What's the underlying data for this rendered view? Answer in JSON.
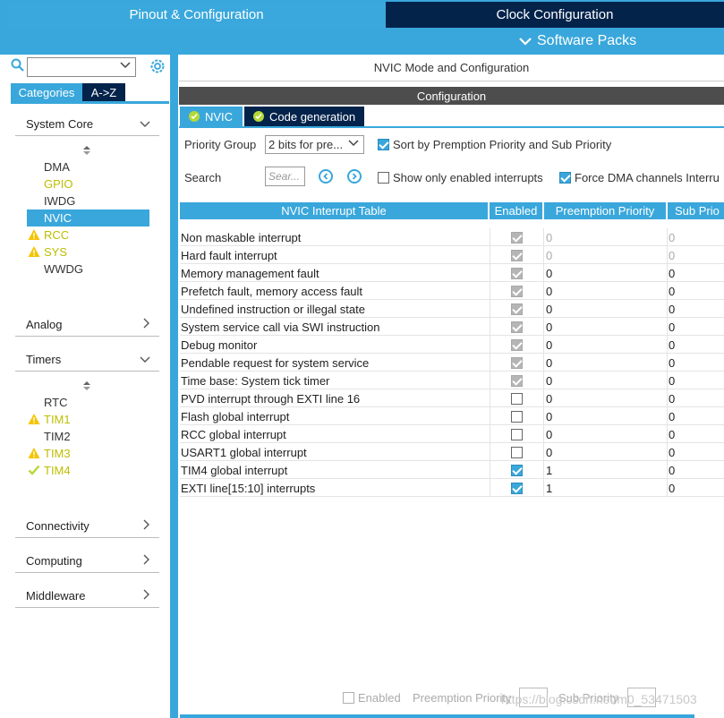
{
  "top": {
    "tab_pinout": "Pinout & Configuration",
    "tab_clock": "Clock Configuration",
    "software_packs": "Software Packs"
  },
  "sidebar": {
    "tab_categories": "Categories",
    "tab_az": "A->Z",
    "sections": {
      "system_core": "System Core",
      "analog": "Analog",
      "timers": "Timers",
      "connectivity": "Connectivity",
      "computing": "Computing",
      "middleware": "Middleware"
    },
    "system_core_items": [
      {
        "label": "DMA",
        "status": "none"
      },
      {
        "label": "GPIO",
        "status": "green"
      },
      {
        "label": "IWDG",
        "status": "none"
      },
      {
        "label": "NVIC",
        "status": "selected"
      },
      {
        "label": "RCC",
        "status": "warning"
      },
      {
        "label": "SYS",
        "status": "warning"
      },
      {
        "label": "WWDG",
        "status": "none"
      }
    ],
    "timers_items": [
      {
        "label": "RTC",
        "status": "none"
      },
      {
        "label": "TIM1",
        "status": "warning"
      },
      {
        "label": "TIM2",
        "status": "none"
      },
      {
        "label": "TIM3",
        "status": "warning"
      },
      {
        "label": "TIM4",
        "status": "ok"
      }
    ]
  },
  "main": {
    "mode_title": "NVIC Mode and Configuration",
    "config_title": "Configuration",
    "tab_nvic": "NVIC",
    "tab_codegen": "Code generation",
    "priority_group_label": "Priority Group",
    "priority_group_value": "2 bits for pre...",
    "sort_label": "Sort by Premption Priority and Sub Priority",
    "sort_checked": true,
    "search_label": "Search",
    "search_placeholder": "Sear...",
    "show_enabled_label": "Show only enabled interrupts",
    "show_enabled_checked": false,
    "force_dma_label": "Force DMA channels Interru",
    "force_dma_checked": true,
    "table": {
      "headers": [
        "NVIC Interrupt Table",
        "Enabled",
        "Preemption Priority",
        "Sub Prio"
      ],
      "rows": [
        {
          "name": "Non maskable interrupt",
          "enabled": "fixed",
          "pre": "0",
          "sub": "0",
          "grey": true
        },
        {
          "name": "Hard fault interrupt",
          "enabled": "fixed",
          "pre": "0",
          "sub": "0",
          "grey": true
        },
        {
          "name": "Memory management fault",
          "enabled": "fixed",
          "pre": "0",
          "sub": "0",
          "grey": false
        },
        {
          "name": "Prefetch fault, memory access fault",
          "enabled": "fixed",
          "pre": "0",
          "sub": "0",
          "grey": false
        },
        {
          "name": "Undefined instruction or illegal state",
          "enabled": "fixed",
          "pre": "0",
          "sub": "0",
          "grey": false
        },
        {
          "name": "System service call via SWI instruction",
          "enabled": "fixed",
          "pre": "0",
          "sub": "0",
          "grey": false
        },
        {
          "name": "Debug monitor",
          "enabled": "fixed",
          "pre": "0",
          "sub": "0",
          "grey": false
        },
        {
          "name": "Pendable request for system service",
          "enabled": "fixed",
          "pre": "0",
          "sub": "0",
          "grey": false
        },
        {
          "name": "Time base: System tick timer",
          "enabled": "fixed",
          "pre": "0",
          "sub": "0",
          "grey": false
        },
        {
          "name": "PVD interrupt through EXTI line 16",
          "enabled": "off",
          "pre": "0",
          "sub": "0",
          "grey": false
        },
        {
          "name": "Flash global interrupt",
          "enabled": "off",
          "pre": "0",
          "sub": "0",
          "grey": false
        },
        {
          "name": "RCC global interrupt",
          "enabled": "off",
          "pre": "0",
          "sub": "0",
          "grey": false
        },
        {
          "name": "USART1 global interrupt",
          "enabled": "off",
          "pre": "0",
          "sub": "0",
          "grey": false
        },
        {
          "name": "TIM4 global interrupt",
          "enabled": "on",
          "pre": "1",
          "sub": "0",
          "grey": false
        },
        {
          "name": "EXTI line[15:10] interrupts",
          "enabled": "on",
          "pre": "1",
          "sub": "0",
          "grey": false
        }
      ]
    },
    "bottom": {
      "enabled_label": "Enabled",
      "preemption_label": "Preemption Priority",
      "sub_label": "Sub Priority"
    },
    "watermark": "https://blog.csdn.net/m0_53471503"
  },
  "colors": {
    "accent": "#39a7db",
    "dark_tab": "#03234b",
    "warning": "#f5c400",
    "ok_green": "#b5d836"
  }
}
